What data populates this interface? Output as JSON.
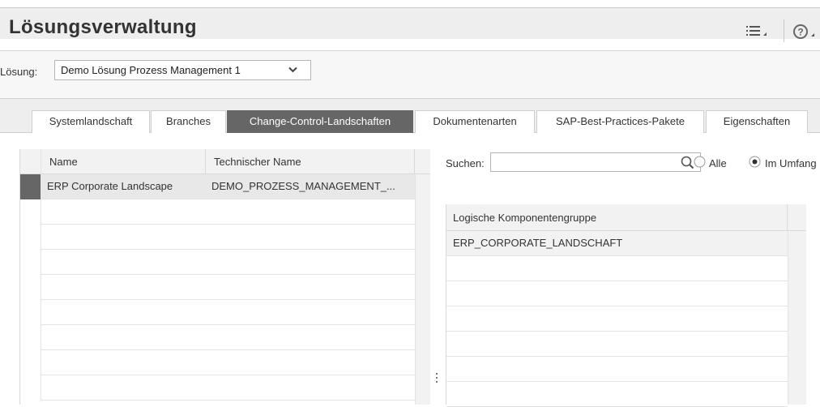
{
  "header": {
    "title": "Lösungsverwaltung",
    "menu_icon": "list-menu-icon",
    "help_icon": "help-icon"
  },
  "solution": {
    "label": "Lösung:",
    "selected": "Demo Lösung Prozess Management 1"
  },
  "tabs": [
    {
      "label": "Systemlandschaft",
      "active": false
    },
    {
      "label": "Branches",
      "active": false
    },
    {
      "label": "Change-Control-Landschaften",
      "active": true
    },
    {
      "label": "Dokumentenarten",
      "active": false
    },
    {
      "label": "SAP-Best-Practices-Pakete",
      "active": false
    },
    {
      "label": "Eigenschaften",
      "active": false
    }
  ],
  "left_table": {
    "columns": [
      "Name",
      "Technischer Name"
    ],
    "rows": [
      {
        "name": "ERP Corporate Landscape",
        "technical_name": "DEMO_PROZESS_MANAGEMENT_...",
        "selected": true
      }
    ]
  },
  "right_panel": {
    "search_label": "Suchen:",
    "search_value": "",
    "radios": [
      {
        "label": "Alle",
        "checked": false
      },
      {
        "label": "Im Umfang",
        "checked": true
      }
    ],
    "table": {
      "columns": [
        "Logische Komponentengruppe"
      ],
      "rows": [
        "ERP_CORPORATE_LANDSCHAFT"
      ]
    }
  },
  "colors": {
    "active_tab": "#666666",
    "header_bg": "#eeeeee",
    "selected_row": "#e8e8e8"
  }
}
